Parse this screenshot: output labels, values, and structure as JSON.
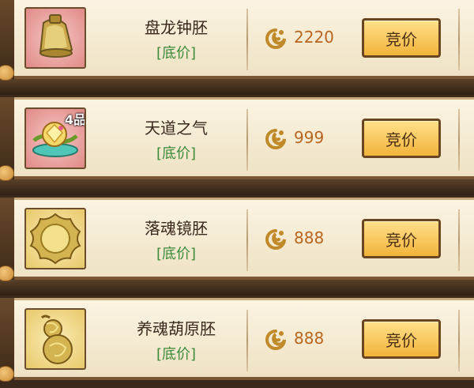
{
  "auction": {
    "items": [
      {
        "name": "盘龙钟胚",
        "tag": "[底价]",
        "price": "2220",
        "bid_label": "竞价",
        "icon": "bell-icon",
        "grade": ""
      },
      {
        "name": "天道之气",
        "tag": "[底价]",
        "price": "999",
        "bid_label": "竞价",
        "icon": "qi-orb-icon",
        "grade": "4品"
      },
      {
        "name": "落魂镜胚",
        "tag": "[底价]",
        "price": "888",
        "bid_label": "竞价",
        "icon": "mirror-icon",
        "grade": ""
      },
      {
        "name": "养魂葫原胚",
        "tag": "[底价]",
        "price": "888",
        "bid_label": "竞价",
        "icon": "gourd-icon",
        "grade": ""
      }
    ]
  },
  "colors": {
    "price": "#b8651e",
    "tag_green": "#3d8a3a",
    "button_gold": "#f2b43a",
    "panel": "#fbf4e2"
  }
}
